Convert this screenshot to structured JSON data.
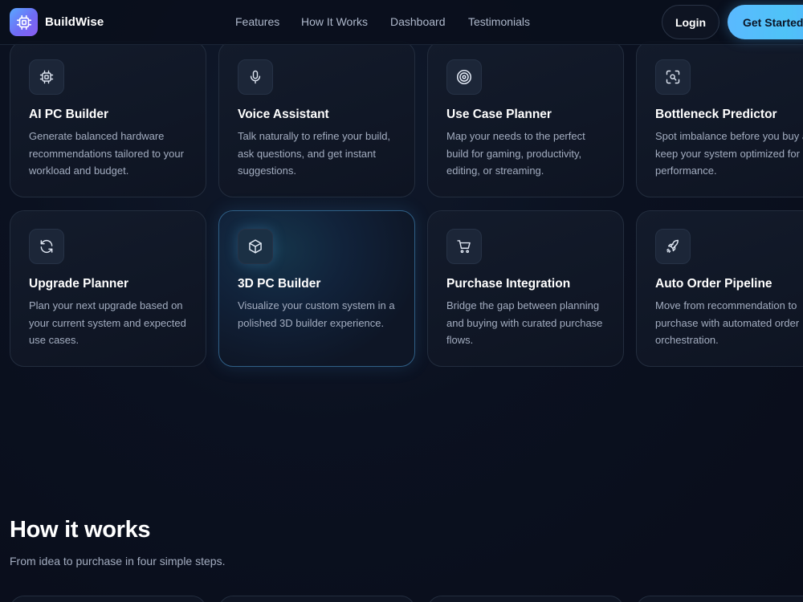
{
  "brand": {
    "name": "BuildWise",
    "icon": "cpu-chip-icon"
  },
  "nav": {
    "links": [
      "Features",
      "How It Works",
      "Dashboard",
      "Testimonials"
    ],
    "login_label": "Login",
    "cta_label": "Get Started"
  },
  "features": [
    {
      "icon": "cpu-chip-icon",
      "title": "AI PC Builder",
      "desc": "Generate balanced hardware recommendations tailored to your workload and budget."
    },
    {
      "icon": "microphone-icon",
      "title": "Voice Assistant",
      "desc": "Talk naturally to refine your build, ask questions, and get instant suggestions."
    },
    {
      "icon": "target-icon",
      "title": "Use Case Planner",
      "desc": "Map your needs to the perfect build for gaming, productivity, editing, or streaming."
    },
    {
      "icon": "scan-search-icon",
      "title": "Bottleneck Predictor",
      "desc": "Spot imbalance before you buy and keep your system optimized for performance."
    },
    {
      "icon": "refresh-icon",
      "title": "Upgrade Planner",
      "desc": "Plan your next upgrade based on your current system and expected use cases."
    },
    {
      "icon": "cube-icon",
      "title": "3D PC Builder",
      "desc": "Visualize your custom system in a polished 3D builder experience."
    },
    {
      "icon": "shopping-cart-icon",
      "title": "Purchase Integration",
      "desc": "Bridge the gap between planning and buying with curated purchase flows."
    },
    {
      "icon": "rocket-icon",
      "title": "Auto Order Pipeline",
      "desc": "Move from recommendation to purchase with automated order orchestration."
    }
  ],
  "how_it_works": {
    "title": "How it works",
    "subtitle": "From idea to purchase in four simple steps."
  },
  "colors": {
    "accent": "#4fc3f7",
    "brand_gradient_start": "#5aa8ff",
    "brand_gradient_end": "#8a5cf0",
    "background": "#0b1120",
    "card_border_active": "#2f5f86"
  }
}
